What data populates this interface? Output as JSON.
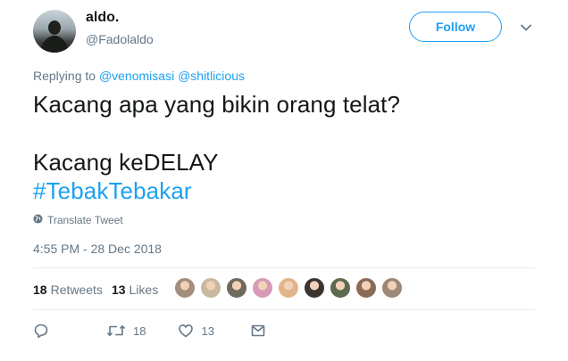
{
  "author": {
    "display_name": "aldo.",
    "handle": "@Fadolaldo"
  },
  "follow": {
    "label": "Follow"
  },
  "reply_context": {
    "prefix": "Replying to",
    "mentions": [
      "@venomisasi",
      "@shitlicious"
    ]
  },
  "tweet": {
    "lines": [
      "Kacang apa yang bikin orang telat?",
      "Kacang keDELAY"
    ],
    "hashtag": "#TebakTebakar"
  },
  "translate": {
    "label": "Translate Tweet",
    "icon": "globe-icon"
  },
  "timestamp": "4:55 PM - 28 Dec 2018",
  "stats": {
    "retweets_count": "18",
    "retweets_label": "Retweets",
    "likes_count": "13",
    "likes_label": "Likes"
  },
  "likers_avatars": [
    {
      "bg": "#a58d7c"
    },
    {
      "bg": "#c8b89f"
    },
    {
      "bg": "#6f6a5c"
    },
    {
      "bg": "#d89ab5"
    },
    {
      "bg": "#e2b48a"
    },
    {
      "bg": "#3a3432"
    },
    {
      "bg": "#5a6b4e"
    },
    {
      "bg": "#8b6b57"
    },
    {
      "bg": "#9d8878"
    }
  ],
  "actions": {
    "reply_icon": "reply-icon",
    "retweet_icon": "retweet-icon",
    "retweet_count": "18",
    "like_icon": "heart-icon",
    "like_count": "13",
    "dm_icon": "envelope-icon"
  },
  "colors": {
    "accent": "#1da1f2",
    "text": "#14171a",
    "muted": "#657786",
    "divider": "#e6ecf0"
  }
}
